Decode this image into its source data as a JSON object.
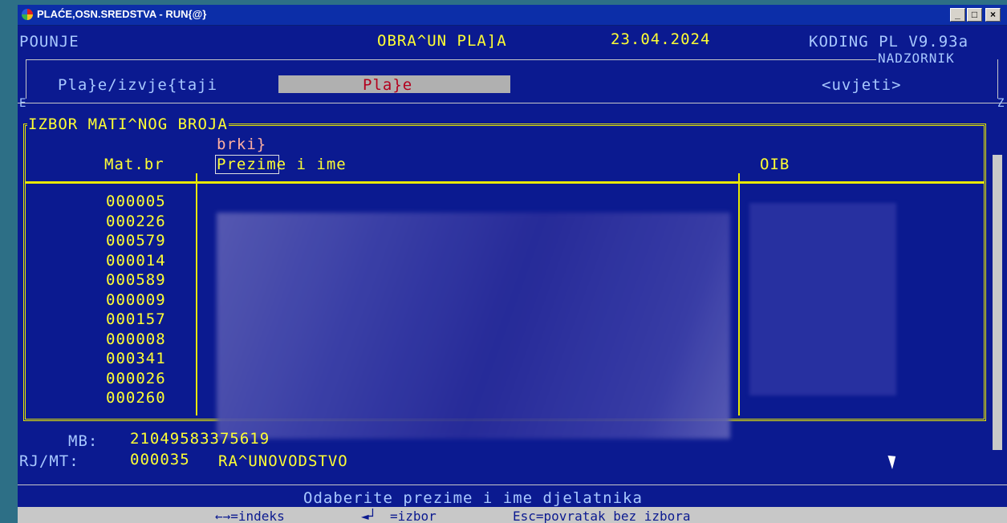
{
  "window": {
    "title": "PLAĆE,OSN.SREDSTVA - RUN{@}",
    "buttons": [
      "_",
      "□",
      "×"
    ]
  },
  "header": {
    "left": "POUNJE",
    "center": "OBRA^UN PLA]A",
    "date": "23.04.2024",
    "version": "KODING PL V9.93a",
    "role": "NADZORNIK"
  },
  "menu": {
    "item1": "Pla}e/izvje{taji",
    "item2": "Pla}e",
    "item3": "<uvjeti>",
    "left_mark": "E",
    "right_mark": "Z"
  },
  "picker": {
    "title": "IZBOR MATI^NOG BROJA",
    "search_value": "brki}",
    "col_mb": "Mat.br",
    "col_name": "Prezime i ime",
    "col_oib": "OIB",
    "rows": [
      "000005",
      "000226",
      "000579",
      "000014",
      "000589",
      "000009",
      "000157",
      "000008",
      "000341",
      "000026",
      "000260"
    ]
  },
  "details": {
    "mb_label": "MB:",
    "mb_value": "21049583375619",
    "rj_label": "RJ/MT:",
    "rj_code": "000035",
    "rj_name": "RA^UNOVODSTVO"
  },
  "footer": {
    "message": "Odaberite prezime i ime djelatnika",
    "hint_index": "←→=indeks",
    "hint_select": "=izbor",
    "hint_escape": "Esc=povratak bez izbora"
  },
  "colors": {
    "screen_bg": "#0b1a90",
    "frame": "#e8e800",
    "text_yellow": "#ffff33"
  }
}
